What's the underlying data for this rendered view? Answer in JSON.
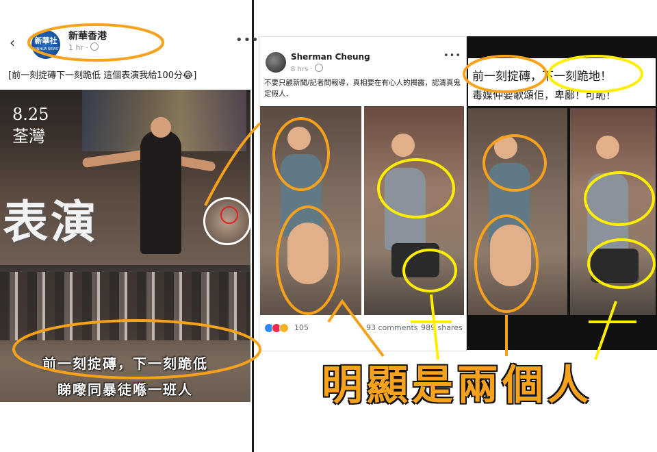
{
  "left_post": {
    "page_name": "新華香港",
    "time": "1 hr",
    "caption": "[前一刻掟磚下一刻跪低 這個表演我給100分😂]",
    "avatar_text_top": "新華社",
    "avatar_text_bottom": "XINHUA NEWS",
    "image_date": "8.25",
    "image_place": "荃灣",
    "image_title": "表演",
    "overlay_line1": "前一刻掟磚，下一刻跪低",
    "overlay_line2": "睇嚟同暴徒喺一班人"
  },
  "middle_post": {
    "author": "Sherman Cheung",
    "time": "8 hrs",
    "text": "不要只顧新聞/記者問報導，真相要在有心人的揭露，認清真鬼定假人．",
    "reaction_count": "105",
    "comments": "93 comments",
    "shares": "989 shares"
  },
  "right_post": {
    "headline": "前一刻掟磚，下一刻跪地！",
    "subline": "毒媒仲要歌頌佢，卑鄙！可恥！"
  },
  "annotation": {
    "caption": "明顯是兩個人",
    "orange": "#f7a21c",
    "yellow": "#ffee00"
  },
  "icons": [
    "back-arrow-icon",
    "more-options-icon",
    "globe-icon",
    "reaction-icons"
  ]
}
